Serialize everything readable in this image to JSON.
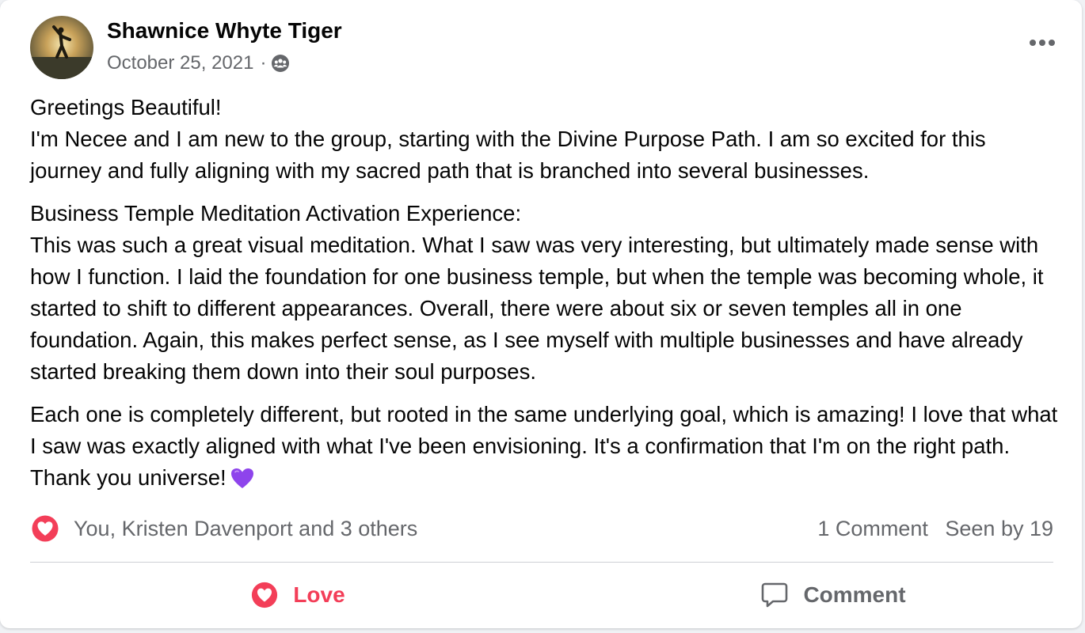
{
  "post": {
    "author": "Shawnice Whyte Tiger",
    "date": "October 25, 2021",
    "separator": "·",
    "audience_icon": "group-icon",
    "more_icon": "more-horizontal-icon",
    "paragraphs": [
      [
        "Greetings Beautiful!",
        "I'm Necee and I am new to the group, starting with the Divine Purpose Path. I am so excited for this journey and fully aligning with my sacred path that is branched into several businesses."
      ],
      [
        "Business Temple Meditation Activation Experience:",
        "This was such a great visual meditation. What I saw was very interesting, but ultimately made sense with how I function. I laid the foundation for one business temple, but when the temple was becoming whole, it started to shift to different appearances. Overall, there were about six or seven temples all in one foundation. Again, this makes perfect sense, as I see myself with multiple businesses and have already started breaking them down into their soul purposes."
      ],
      [
        "Each one is completely different, but rooted in the same underlying goal, which is amazing! I love that what I saw was exactly aligned with what I've been envisioning. It's a confirmation that I'm on the right path. Thank you universe!"
      ]
    ],
    "trailing_emoji": "purple-heart-icon"
  },
  "stats": {
    "reactions_text": "You, Kristen Davenport and 3 others",
    "comments_text": "1 Comment",
    "seen_text": "Seen by 19"
  },
  "actions": {
    "love_label": "Love",
    "comment_label": "Comment"
  },
  "colors": {
    "love": "#f33e58",
    "secondary_text": "#65676b",
    "purple_heart": "#8e44ec"
  }
}
